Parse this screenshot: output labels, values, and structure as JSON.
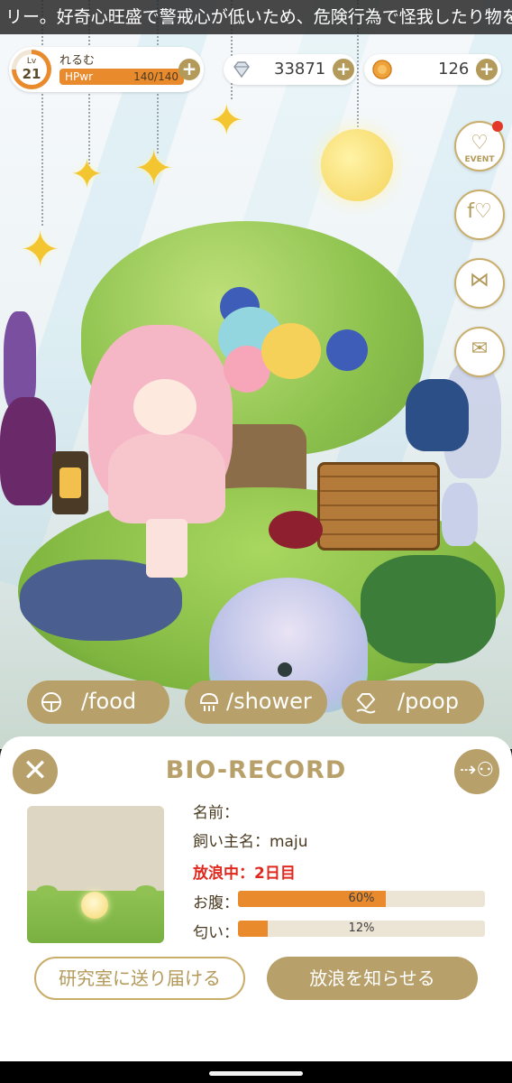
{
  "ticker": {
    "text": "リー。好奇心旺盛で警戒心が低いため、危険行為で怪我したり物を壊"
  },
  "player": {
    "level_label": "Lv",
    "level": "21",
    "name": "れるむ",
    "hp_label": "HPwr",
    "hp_value": "140/140",
    "level_progress": 0.75
  },
  "currency": {
    "gems": "33871",
    "coins": "126"
  },
  "side_menu": {
    "event_label": "EVENT",
    "icons": [
      "event-icon",
      "friends-icon",
      "gift-icon",
      "mail-icon"
    ]
  },
  "commands": [
    {
      "label": "/food",
      "icon": "food-bowl-icon"
    },
    {
      "label": "/shower",
      "icon": "shower-icon"
    },
    {
      "label": "/poop",
      "icon": "poop-icon"
    }
  ],
  "bio_record": {
    "title": "BIO-RECORD",
    "name_label": "名前：",
    "owner_label": "飼い主名：",
    "owner_value": "maju",
    "status_label": "放浪中：",
    "status_value": "2日目",
    "hunger_label": "お腹：",
    "hunger_value": "60%",
    "hunger_fraction": 0.6,
    "smell_label": "匂い：",
    "smell_value": "12%",
    "smell_fraction": 0.12,
    "send_button": "研究室に送り届ける",
    "notify_button": "放浪を知らせる"
  },
  "colors": {
    "accent": "#b8a06a",
    "bar_fill": "#e98a2c",
    "status_red": "#e0281e",
    "notification": "#e2392b"
  }
}
